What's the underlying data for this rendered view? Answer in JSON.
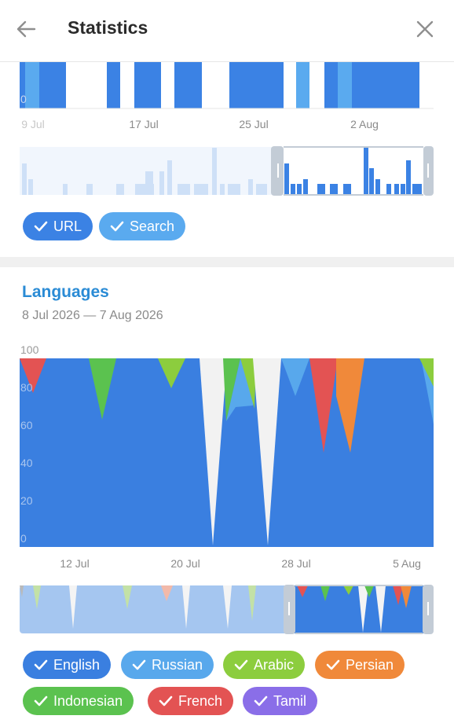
{
  "header": {
    "title": "Statistics"
  },
  "card1": {
    "axis_ticks": [
      "9 Jul",
      "17 Jul",
      "25 Jul",
      "2 Aug"
    ],
    "y_zero_label": "0",
    "chips": [
      {
        "label": "URL",
        "color": "#3b82e4"
      },
      {
        "label": "Search",
        "color": "#5aaaef"
      }
    ]
  },
  "card2": {
    "title": "Languages",
    "subtitle": "8 Jul 2026 — 7 Aug 2026",
    "y_labels": [
      "100",
      "80",
      "60",
      "40",
      "20",
      "0"
    ],
    "x_ticks": [
      "12 Jul",
      "20 Jul",
      "28 Jul",
      "5 Aug"
    ],
    "chips": [
      {
        "label": "English",
        "color": "#3a7fe0"
      },
      {
        "label": "Russian",
        "color": "#58a8ec"
      },
      {
        "label": "Arabic",
        "color": "#8ccd3e"
      },
      {
        "label": "Persian",
        "color": "#f0893a"
      },
      {
        "label": "Indonesian",
        "color": "#5bc24f"
      },
      {
        "label": "French",
        "color": "#e35353"
      },
      {
        "label": "Tamil",
        "color": "#8a6ee8"
      }
    ]
  },
  "chart_data": [
    {
      "type": "bar",
      "ylabel": "",
      "x_ticks": [
        "9 Jul",
        "17 Jul",
        "25 Jul",
        "2 Aug"
      ],
      "series": [
        {
          "name": "URL",
          "color": "#3b82e4"
        },
        {
          "name": "Search",
          "color": "#5aaaef"
        }
      ]
    },
    {
      "type": "area",
      "title": "Languages",
      "subtitle": "8 Jul 2026 — 7 Aug 2026",
      "ylim": [
        0,
        100
      ],
      "x_ticks": [
        "12 Jul",
        "20 Jul",
        "28 Jul",
        "5 Aug"
      ],
      "series": [
        {
          "name": "English",
          "color": "#3a7fe0"
        },
        {
          "name": "Russian",
          "color": "#58a8ec"
        },
        {
          "name": "Arabic",
          "color": "#8ccd3e"
        },
        {
          "name": "Persian",
          "color": "#f0893a"
        },
        {
          "name": "Indonesian",
          "color": "#5bc24f"
        },
        {
          "name": "French",
          "color": "#e35353"
        },
        {
          "name": "Tamil",
          "color": "#8a6ee8"
        }
      ]
    }
  ]
}
